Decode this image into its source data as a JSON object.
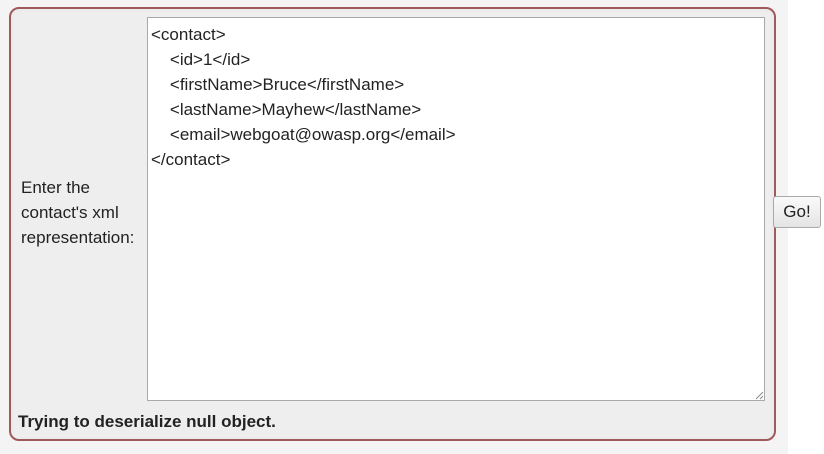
{
  "form": {
    "label": "Enter the contact's xml representation:",
    "xml_value": "<contact>\n    <id>1</id>\n    <firstName>Bruce</firstName>\n    <lastName>Mayhew</lastName>\n    <email>webgoat@owasp.org</email>\n</contact>",
    "submit_label": "Go!"
  },
  "status": {
    "message": "Trying to deserialize null object."
  },
  "colors": {
    "panel_border": "#a15a5a",
    "panel_background": "#ececec"
  }
}
